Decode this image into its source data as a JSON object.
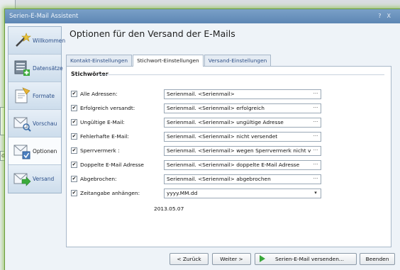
{
  "window": {
    "title": "Serien-E-Mail Assistent",
    "help_glyph": "?",
    "close_glyph": "X"
  },
  "background": {
    "fragment_text": "de"
  },
  "nav": {
    "items": [
      {
        "label": "Willkommen",
        "icon": "wand-icon",
        "active": false
      },
      {
        "label": "Datensätze",
        "icon": "database-icon",
        "active": false
      },
      {
        "label": "Formate",
        "icon": "format-icon",
        "active": false
      },
      {
        "label": "Vorschau",
        "icon": "preview-icon",
        "active": false
      },
      {
        "label": "Optionen",
        "icon": "options-icon",
        "active": true
      },
      {
        "label": "Versand",
        "icon": "send-icon",
        "active": false
      }
    ]
  },
  "main": {
    "title": "Optionen für den Versand der E-Mails",
    "tabs": [
      {
        "label": "Kontakt-Einstellungen",
        "active": false
      },
      {
        "label": "Stichwort-Einstellungen",
        "active": true
      },
      {
        "label": "Versand-Einstellungen",
        "active": false
      }
    ],
    "group_title": "Stichwörter",
    "rows": [
      {
        "label": "Alle Adressen:",
        "value": "Serienmail. <Serienmail>",
        "checked": true
      },
      {
        "label": "Erfolgreich versandt:",
        "value": "Serienmail. <Serienmail> erfolgreich",
        "checked": true
      },
      {
        "label": "Ungültige E-Mail:",
        "value": "Serienmail. <Serienmail> ungültige Adresse",
        "checked": true
      },
      {
        "label": "Fehlerhafte E-Mail:",
        "value": "Serienmail. <Serienmail> nicht versendet",
        "checked": true
      },
      {
        "label": "Sperrvermerk :",
        "value": "Serienmail. <Serienmail> wegen Sperrvermerk nicht v...",
        "checked": true
      },
      {
        "label": "Doppelte E-Mail Adresse",
        "value": "Serienmail. <Serienmail> doppelte E-Mail Adresse",
        "checked": true
      },
      {
        "label": "Abgebrochen:",
        "value": "Serienmail. <Serienmail> abgebrochen",
        "checked": true
      },
      {
        "label": "Zeitangabe  anhängen:",
        "value": "yyyy.MM.dd",
        "checked": true
      }
    ],
    "ellipsis": "···",
    "dropdown_glyph": "▾",
    "checkmark": "✔",
    "date_preview": "2013.05.07"
  },
  "buttons": {
    "back": "< Zurück",
    "next": "Weiter >",
    "send": "Serien-E-Mail versenden...",
    "finish": "Beenden"
  },
  "colors": {
    "accent_glow": "#8cc63f",
    "title_bar": "#6a93c0",
    "link_text": "#2e4f86"
  }
}
